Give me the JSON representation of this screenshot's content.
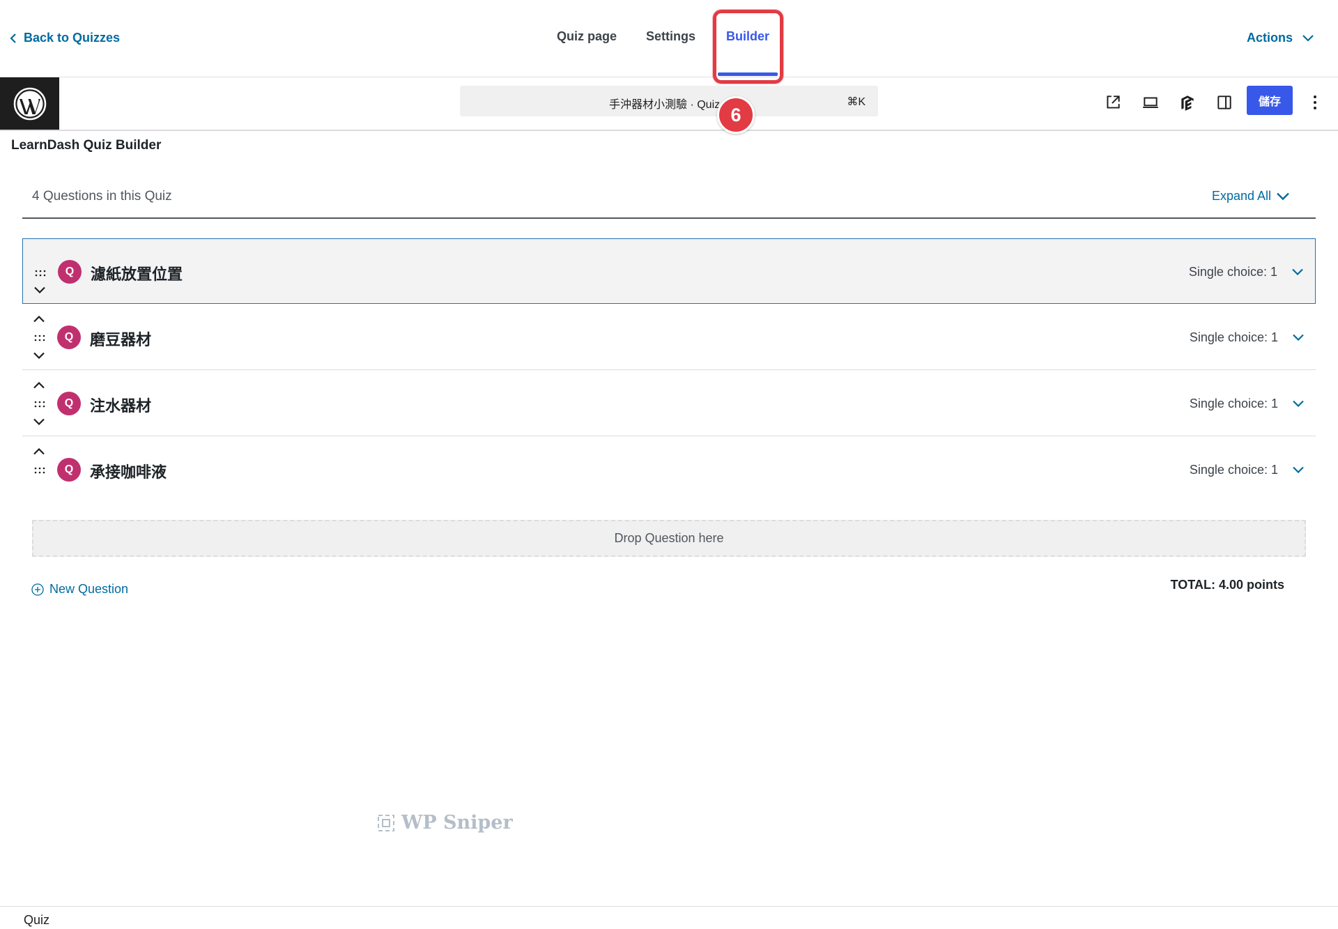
{
  "header": {
    "back_label": "Back to Quizzes",
    "tabs": [
      {
        "label": "Quiz page"
      },
      {
        "label": "Settings"
      },
      {
        "label": "Builder"
      }
    ],
    "actions_label": "Actions"
  },
  "editor": {
    "document_title": "手沖器材小測驗 · Quiz",
    "shortcut": "⌘K",
    "save_label": "儲存",
    "step_number": "6",
    "toolbar_icons": [
      "external-link-icon",
      "device-preview-icon",
      "learndash-icon",
      "sidebar-toggle-icon",
      "more-options-icon"
    ]
  },
  "builder": {
    "title": "LearnDash Quiz Builder",
    "question_count": "4 Questions in this Quiz",
    "expand_all_label": "Expand All",
    "questions": [
      {
        "badge": "Q",
        "title": "濾紙放置位置",
        "type": "Single choice: 1"
      },
      {
        "badge": "Q",
        "title": "磨豆器材",
        "type": "Single choice: 1"
      },
      {
        "badge": "Q",
        "title": "注水器材",
        "type": "Single choice: 1"
      },
      {
        "badge": "Q",
        "title": "承接咖啡液",
        "type": "Single choice: 1"
      }
    ],
    "drop_zone_label": "Drop Question here",
    "new_question_label": "New Question",
    "total_points": "TOTAL: 4.00 points"
  },
  "watermark": "WP Sniper",
  "footer": {
    "label": "Quiz"
  },
  "colors": {
    "accent": "#3858e9",
    "link": "#006ba1",
    "highlight": "#e23b44",
    "question_badge": "#c0306e"
  }
}
